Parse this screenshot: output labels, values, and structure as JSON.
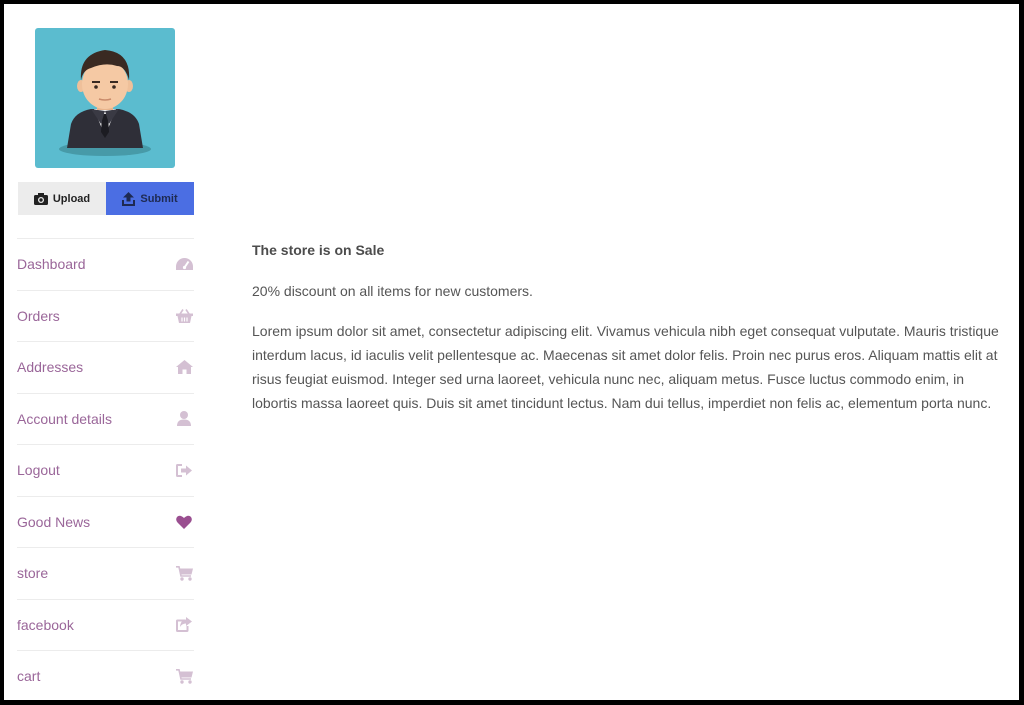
{
  "sidebar": {
    "upload_label": "Upload",
    "submit_label": "Submit",
    "items": [
      {
        "label": "Dashboard",
        "icon": "dashboard-icon"
      },
      {
        "label": "Orders",
        "icon": "basket-icon"
      },
      {
        "label": "Addresses",
        "icon": "home-icon"
      },
      {
        "label": "Account details",
        "icon": "user-icon"
      },
      {
        "label": "Logout",
        "icon": "sign-out-icon"
      },
      {
        "label": "Good News",
        "icon": "heart-icon"
      },
      {
        "label": "store",
        "icon": "cart-icon"
      },
      {
        "label": "facebook",
        "icon": "external-share-icon"
      },
      {
        "label": "cart",
        "icon": "cart-icon"
      }
    ]
  },
  "content": {
    "heading": "The store is on Sale",
    "lead": "20% discount on all items for new customers.",
    "body": "Lorem ipsum dolor sit amet, consectetur adipiscing elit. Vivamus vehicula nibh eget consequat vulputate. Mauris tristique interdum lacus, id iaculis velit pellentesque ac. Maecenas sit amet dolor felis. Proin nec purus eros. Aliquam mattis elit at risus feugiat euismod. Integer sed urna laoreet, vehicula nunc nec, aliquam metus. Fusce luctus commodo enim, in lobortis massa laoreet quis. Duis sit amet tincidunt lectus. Nam dui tellus, imperdiet non felis ac, elementum porta nunc."
  },
  "colors": {
    "avatar_bg": "#5bbccf",
    "submit_bg": "#4b6ee3",
    "link": "#9a6699",
    "icon": "#d4c0d3",
    "heart": "#9a4f90"
  }
}
